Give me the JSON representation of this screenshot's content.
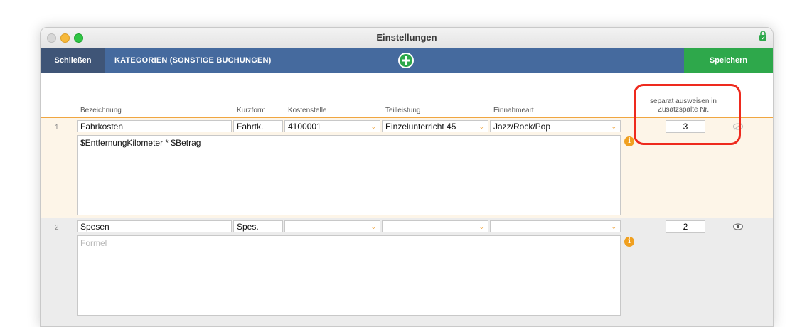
{
  "window": {
    "title": "Einstellungen"
  },
  "toolbar": {
    "close_label": "Schließen",
    "section_title": "KATEGORIEN (SONSTIGE BUCHUNGEN)",
    "save_label": "Speichern"
  },
  "columns": {
    "bezeichnung": "Bezeichnung",
    "kurzform": "Kurzform",
    "kostenstelle": "Kostenstelle",
    "teilleistung": "Teilleistung",
    "einnahmeart": "Einnahmeart",
    "separat": "separat ausweisen in Zusatzspalte Nr."
  },
  "rows": [
    {
      "num": "1",
      "bezeichnung": "Fahrkosten",
      "kurzform": "Fahrtk.",
      "kostenstelle": "4100001",
      "teilleistung": "Einzelunterricht 45",
      "einnahmeart": "Jazz/Rock/Pop",
      "formula": "$EntfernungKilometer * $Betrag",
      "zusatzspalte": "3"
    },
    {
      "num": "2",
      "bezeichnung": "Spesen",
      "kurzform": "Spes.",
      "kostenstelle": "",
      "teilleistung": "",
      "einnahmeart": "",
      "formula_placeholder": "Formel",
      "zusatzspalte": "2"
    }
  ],
  "icons": {
    "add": "plus-circle-icon",
    "info": "info-icon",
    "eye": "eye-icon",
    "lock": "lock-icon"
  },
  "colors": {
    "toolbar": "#456a9e",
    "close_button": "#3f5577",
    "save_button": "#2ea84b",
    "highlight": "#ee2a1e",
    "row_highlight": "#fdf5e8",
    "accent": "#f0a641"
  }
}
